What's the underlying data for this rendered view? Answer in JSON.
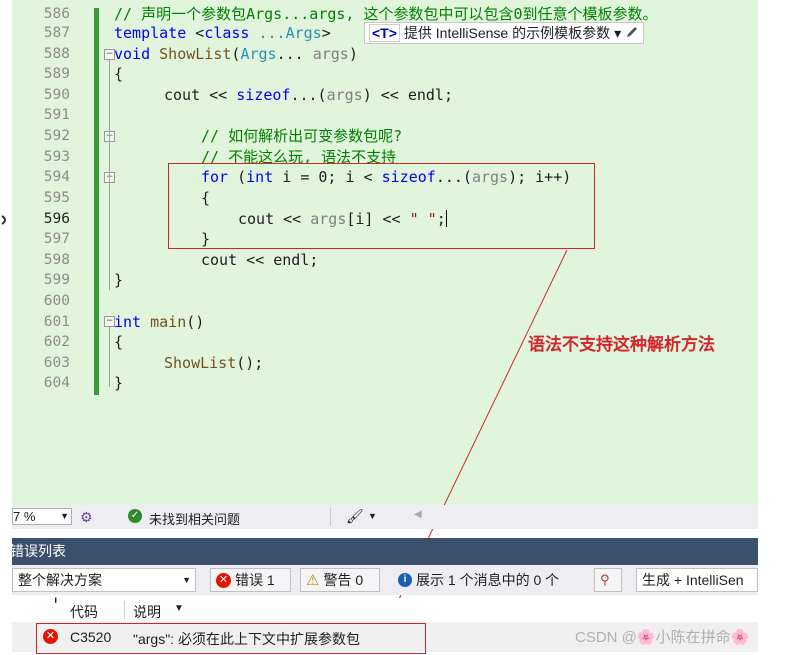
{
  "editor": {
    "line_numbers": [
      "586",
      "587",
      "588",
      "589",
      "590",
      "591",
      "592",
      "593",
      "594",
      "595",
      "596",
      "597",
      "598",
      "599",
      "600",
      "601",
      "602",
      "603",
      "604"
    ],
    "lines": {
      "l586": "// 声明一个参数包Args...args, 这个参数包中可以包含0到任意个模板参数。",
      "l587_kw1": "template",
      "l587_kw2": "class",
      "l587_ty": "...Args",
      "l588_kw": "void",
      "l588_fn": "ShowList",
      "l588_ty": "Args",
      "l588_rest": "... ",
      "l588_pm": "args",
      "l590_a": "cout ",
      "l590_b": "<< ",
      "l590_kw": "sizeof",
      "l590_c": "...(",
      "l590_pm": "args",
      "l590_d": ") ",
      "l590_e": "<< ",
      "l590_f": "endl;",
      "l592": "// 如何解析出可变参数包呢?",
      "l593": "// 不能这么玩, 语法不支持",
      "l594_kw1": "for",
      "l594_kw2": "int",
      "l594_a": " i = 0; i < ",
      "l594_kw3": "sizeof",
      "l594_b": "...(",
      "l594_pm": "args",
      "l594_c": "); i++)",
      "l596_a": "cout << ",
      "l596_pm": "args",
      "l596_b": "[i] << ",
      "l596_st": "\" \"",
      "l596_c": ";",
      "l598_a": "cout ",
      "l598_b": "<< ",
      "l598_c": "endl;",
      "l601_kw": "int",
      "l601_fn": "main",
      "l601_rest": "()",
      "l603_fn": "ShowList",
      "l603_rest": "();",
      "brace_open": "{",
      "brace_close": "}"
    },
    "intellisense_hint": {
      "tag": "<T>",
      "text": "提供 IntelliSense 的示例模板参数",
      "dropdown": "▾",
      "edit_icon": "pencil-icon"
    }
  },
  "annotation": {
    "text": "语法不支持这种解析方法"
  },
  "status_bar": {
    "zoom": "7 %",
    "status_text": "未找到相关问题"
  },
  "error_list": {
    "title": "错误列表",
    "scope": "整个解决方案",
    "errors_label": "错误 1",
    "warnings_label": "警告 0",
    "messages_label": "展示 1 个消息中的 0 个",
    "build_filter": "生成 + IntelliSen",
    "columns": {
      "code": "代码",
      "description": "说明"
    },
    "rows": [
      {
        "code": "C3520",
        "description": "\"args\": 必须在此上下文中扩展参数包"
      }
    ]
  },
  "watermark": "CSDN @&#x1F338;小陈在拼命&#x1F338;",
  "colors": {
    "editor_bg": "#e1f5dd",
    "accent_red": "#d2262c",
    "panel_title": "#3c506d"
  }
}
